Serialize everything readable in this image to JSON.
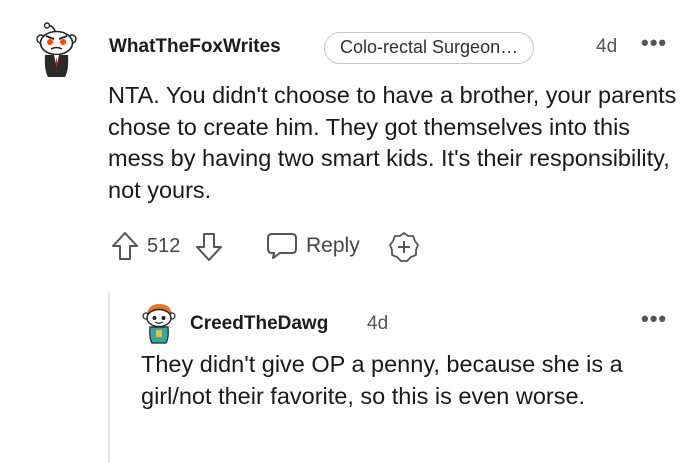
{
  "comment": {
    "username": "WhatTheFoxWrites",
    "flair": "Colo-rectal Surgeon…",
    "timestamp": "4d",
    "more": "•••",
    "body": "NTA. You didn't choose to have a brother, your parents chose to create him. They got themselves into this mess by having two smart kids. It's their responsibility, not yours.",
    "score": "512",
    "reply_label": "Reply"
  },
  "reply": {
    "username": "CreedTheDawg",
    "timestamp": "4d",
    "more": "•••",
    "body": "They didn't give OP a penny, because she is a girl/not their favorite, so this is even worse."
  },
  "icons": {
    "upvote": "upvote-arrow-icon",
    "downvote": "downvote-arrow-icon",
    "reply": "speech-bubble-icon",
    "award": "award-plus-icon"
  },
  "colors": {
    "text": "#1a1a1b",
    "muted": "#555555",
    "thread_line": "#e4e4e4"
  }
}
